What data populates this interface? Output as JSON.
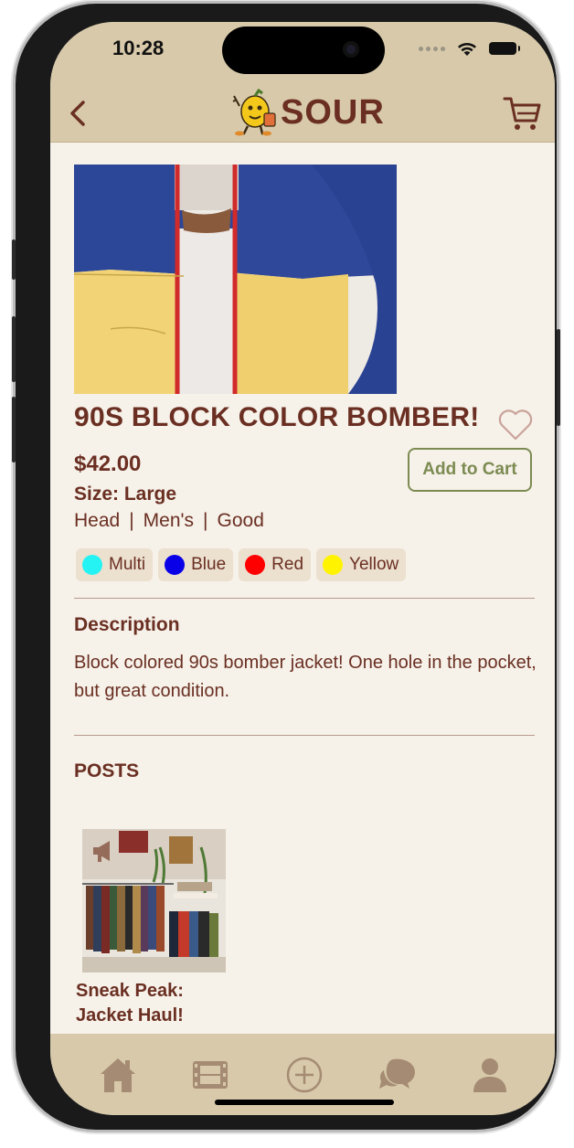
{
  "status_bar": {
    "time": "10:28"
  },
  "header": {
    "brand": "SOUR",
    "back_icon": "chevron-left-icon",
    "cart_icon": "cart-icon"
  },
  "product": {
    "title": "90S BLOCK COLOR BOMBER!",
    "price": "$42.00",
    "size": "Size: Large",
    "meta": [
      "Head",
      "|",
      "Men's",
      "|",
      "Good"
    ],
    "add_to_cart_label": "Add to Cart",
    "favorite_icon": "heart-outline-icon",
    "colors": [
      {
        "label": "Multi",
        "swatch": "#25f3f3"
      },
      {
        "label": "Blue",
        "swatch": "#0a00e8"
      },
      {
        "label": "Red",
        "swatch": "#ff0000"
      },
      {
        "label": "Yellow",
        "swatch": "#fff300"
      }
    ]
  },
  "description": {
    "heading": "Description",
    "text": "Block colored 90s bomber jacket! One hole in the pocket, but great condition."
  },
  "posts": {
    "heading": "POSTS",
    "items": [
      {
        "title": "Sneak Peak: Jacket Haul!",
        "icon": "megaphone-icon"
      }
    ]
  },
  "tabbar": {
    "items": [
      "home-icon",
      "film-icon",
      "add-circle-icon",
      "chat-bubbles-icon",
      "profile-icon"
    ]
  },
  "colors": {
    "brand_brown": "#6a2f22",
    "header_tan": "#d7c9a9",
    "background": "#f6f1e9",
    "accent_green": "#7c8b52",
    "chip_bg": "#ece0cf",
    "tab_icon": "#a58b73"
  }
}
